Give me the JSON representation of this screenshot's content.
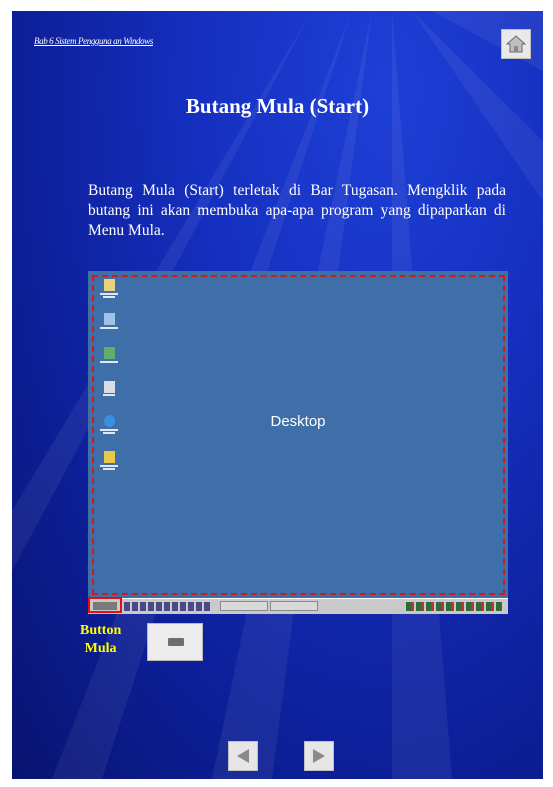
{
  "header": {
    "breadcrumb": "Bab 6 Sistem Pengguna an Windows",
    "home_icon": "home-icon"
  },
  "slide": {
    "title": "Butang Mula (Start)",
    "body": "Butang Mula (Start) terletak di Bar Tugasan. Mengklik pada butang ini akan membuka apa-apa program yang dipaparkan di Menu Mula."
  },
  "screenshot": {
    "desktop_label": "Desktop",
    "desktop_icons": [
      "my-documents-icon",
      "my-computer-icon",
      "network-icon",
      "trash-icon",
      "internet-explorer-icon",
      "outlook-icon"
    ]
  },
  "callout": {
    "line1": "Button",
    "line2": "Mula"
  },
  "navigation": {
    "prev_icon": "arrow-left-icon",
    "next_icon": "arrow-right-icon"
  },
  "colors": {
    "background": "#1530c0",
    "highlight": "#d11b1b",
    "callout_text": "#ffff00"
  }
}
